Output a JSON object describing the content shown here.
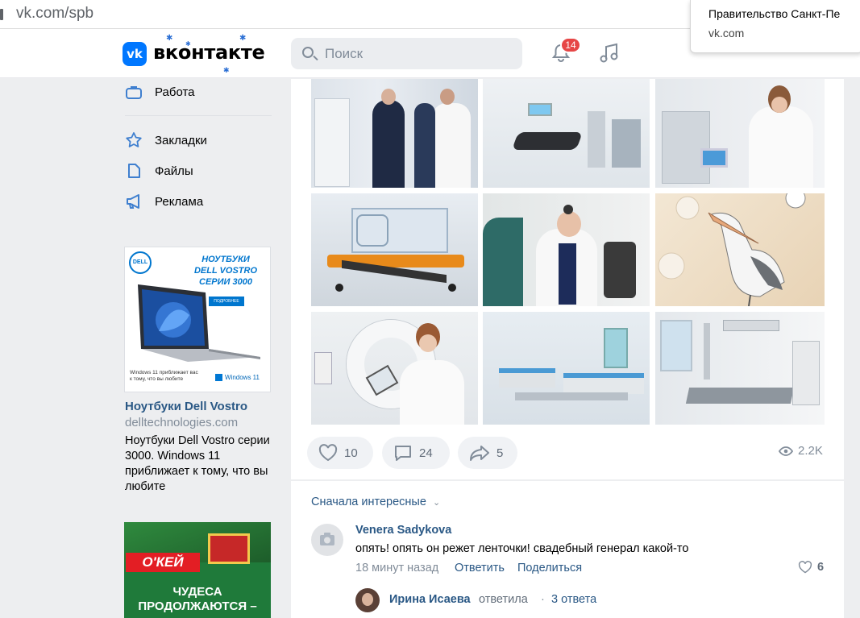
{
  "browser": {
    "url": "vk.com/spb"
  },
  "popup": {
    "title": "Правительство Санкт-Пе",
    "site": "vk.com"
  },
  "header": {
    "logo_text": "вконтакте",
    "logo_letters": "vk",
    "search_placeholder": "Поиск",
    "notifications_count": "14"
  },
  "sidebar": {
    "items": [
      {
        "label": "Работа",
        "icon": "briefcase-icon"
      },
      {
        "label": "Закладки",
        "icon": "star-icon"
      },
      {
        "label": "Файлы",
        "icon": "file-icon"
      },
      {
        "label": "Реклама",
        "icon": "megaphone-icon"
      }
    ]
  },
  "ad": {
    "banner_heading_1": "НОУТБУКИ",
    "banner_heading_2": "DELL VOSTRO",
    "banner_heading_3": "СЕРИИ 3000",
    "banner_button": "ПОДРОБНЕЕ",
    "banner_caption": "Windows 11 приближает вас к тому, что вы любите",
    "banner_windows": "Windows 11",
    "brand": "DELL",
    "title": "Ноутбуки Dell Vostro",
    "domain": "delltechnologies.com",
    "description": "Ноутбуки Dell Vostro серии 3000. Windows 11 приближает к тому, что вы любите"
  },
  "ad2": {
    "brand": "О'КЕЙ",
    "line1": "ЧУДЕСА",
    "line2": "ПРОДОЛЖАЮТСЯ –"
  },
  "post": {
    "likes": "10",
    "comments": "24",
    "shares": "5",
    "views": "2.2K"
  },
  "comments": {
    "sort_label": "Сначала интересные",
    "first": {
      "author": "Venera Sadykova",
      "text": "опять! опять он режет ленточки! свадебный генерал какой-то",
      "time": "18 минут назад",
      "reply": "Ответить",
      "share": "Поделиться",
      "likes": "6"
    },
    "reply_preview": {
      "author": "Ирина Исаева",
      "action": "ответила",
      "dot": "·",
      "count": "3 ответа"
    }
  },
  "colors": {
    "accent": "#0077ff",
    "link": "#2a5885",
    "badge": "#e64646",
    "background": "#edeef0"
  }
}
